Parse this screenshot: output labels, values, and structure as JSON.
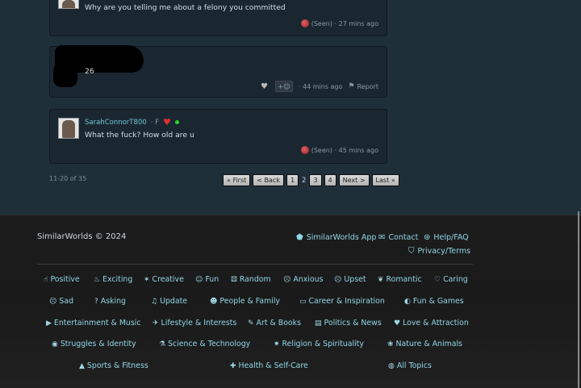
{
  "messages": [
    {
      "text": "Why are you telling me about a felony you committed",
      "status": "(Seen) · 27 mins ago"
    },
    {
      "text": "26",
      "time": "· 44 mins ago",
      "report": "Report",
      "react": "+☺"
    },
    {
      "username": "SarahConnorT800",
      "sex": "· F",
      "text": "What the fuck? How old are u",
      "status": "(Seen) · 45 mins ago"
    }
  ],
  "pager": {
    "info": "11-20 of 35",
    "first": "« First",
    "back": "< Back",
    "p1": "1",
    "p2": "2",
    "p3": "3",
    "p4": "4",
    "next": "Next >",
    "last": "Last »"
  },
  "footer": {
    "copyright": "SimilarWorlds © 2024",
    "app": "SimilarWorlds App",
    "contact": "Contact",
    "help": "Help/FAQ",
    "privacy": "Privacy/Terms"
  },
  "topics": {
    "positive": "Positive",
    "exciting": "Exciting",
    "creative": "Creative",
    "fun": "Fun",
    "random": "Random",
    "anxious": "Anxious",
    "upset": "Upset",
    "romantic": "Romantic",
    "caring": "Caring",
    "sad": "Sad",
    "asking": "Asking",
    "update": "Update",
    "people": "People & Family",
    "career": "Career & Inspiration",
    "games": "Fun & Games",
    "entertainment": "Entertainment & Music",
    "lifestyle": "Lifestyle & Interests",
    "art": "Art & Books",
    "politics": "Politics & News",
    "love": "Love & Attraction",
    "struggles": "Struggles & Identity",
    "science": "Science & Technology",
    "religion": "Religion & Spirituality",
    "nature": "Nature & Animals",
    "sports": "Sports & Fitness",
    "health": "Health & Self-Care",
    "all": "All Topics"
  }
}
